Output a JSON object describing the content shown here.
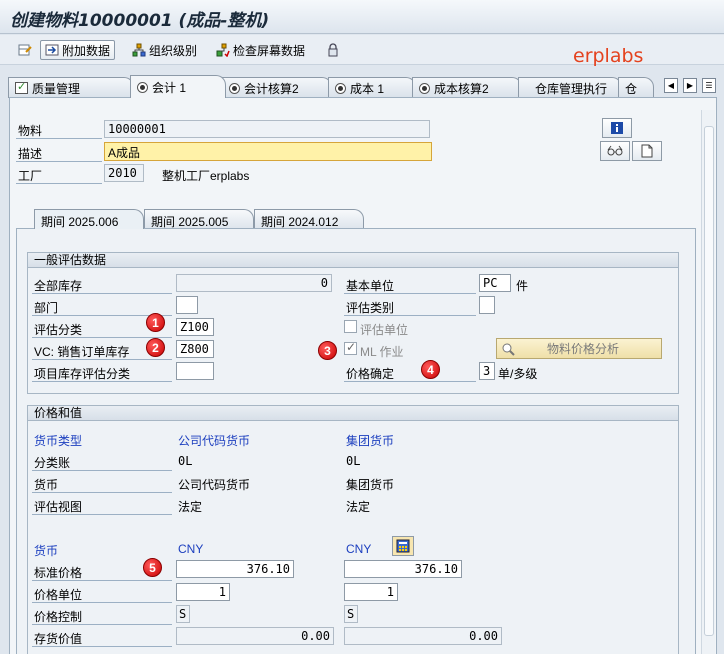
{
  "window": {
    "title": "创建物料10000001 (成品-整机)"
  },
  "watermark": "erplabs",
  "toolbar": {
    "additional_data": "附加数据",
    "org_levels": "组织级别",
    "check_screen_data": "检查屏幕数据"
  },
  "tabs": [
    {
      "label": "质量管理",
      "icon": "check-icon"
    },
    {
      "label": "会计 1",
      "icon": "radio-icon",
      "active": true
    },
    {
      "label": "会计核算2",
      "icon": "radio-icon"
    },
    {
      "label": "成本 1",
      "icon": "radio-icon"
    },
    {
      "label": "成本核算2",
      "icon": "radio-icon"
    },
    {
      "label": "仓库管理执行",
      "icon": ""
    },
    {
      "label": "仓",
      "icon": ""
    }
  ],
  "header": {
    "material_label": "物料",
    "material_value": "10000001",
    "description_label": "描述",
    "description_value": "A成品",
    "plant_label": "工厂",
    "plant_value": "2010",
    "plant_name": "整机工厂erplabs"
  },
  "period_tabs": [
    "期间 2025.006",
    "期间 2025.005",
    "期间 2024.012"
  ],
  "general": {
    "header": "一般评估数据",
    "total_stock_label": "全部库存",
    "total_stock_value": "0",
    "base_unit_label": "基本单位",
    "base_unit_value": "PC",
    "base_unit_text": "件",
    "division_label": "部门",
    "division_value": "",
    "valuation_category_label": "评估类别",
    "valuation_category_value": "",
    "valuation_class_label": "评估分类",
    "valuation_class_value": "Z100",
    "valuated_unit_label": "评估单位",
    "vc_label": "VC: 销售订单库存",
    "vc_value": "Z800",
    "ml_label": "ML 作业",
    "price_analysis_label": "物料价格分析",
    "project_stock_label": "项目库存评估分类",
    "project_stock_value": "",
    "price_determination_label": "价格确定",
    "price_determination_value": "3",
    "price_determination_text": "单/多级"
  },
  "prices": {
    "header": "价格和值",
    "currency_type_label": "货币类型",
    "company_code_currency": "公司代码货币",
    "group_currency": "集团货币",
    "ledger_label": "分类账",
    "ledger_cc": "0L",
    "ledger_grp": "0L",
    "currency_label": "货币",
    "currency_cc": "公司代码货币",
    "currency_grp": "集团货币",
    "valuation_view_label": "评估视图",
    "view_cc": "法定",
    "view_grp": "法定",
    "curr_label2": "货币",
    "curr_cc_value": "CNY",
    "curr_grp_value": "CNY",
    "standard_price_label": "标准价格",
    "std_cc": "376.10",
    "std_grp": "376.10",
    "price_unit_label": "价格单位",
    "pu_cc": "1",
    "pu_grp": "1",
    "price_control_label": "价格控制",
    "pc_cc": "S",
    "pc_grp": "S",
    "inventory_value_label": "存货价值",
    "iv_cc": "0.00",
    "iv_grp": "0.00"
  },
  "badges": [
    "1",
    "2",
    "3",
    "4",
    "5"
  ]
}
